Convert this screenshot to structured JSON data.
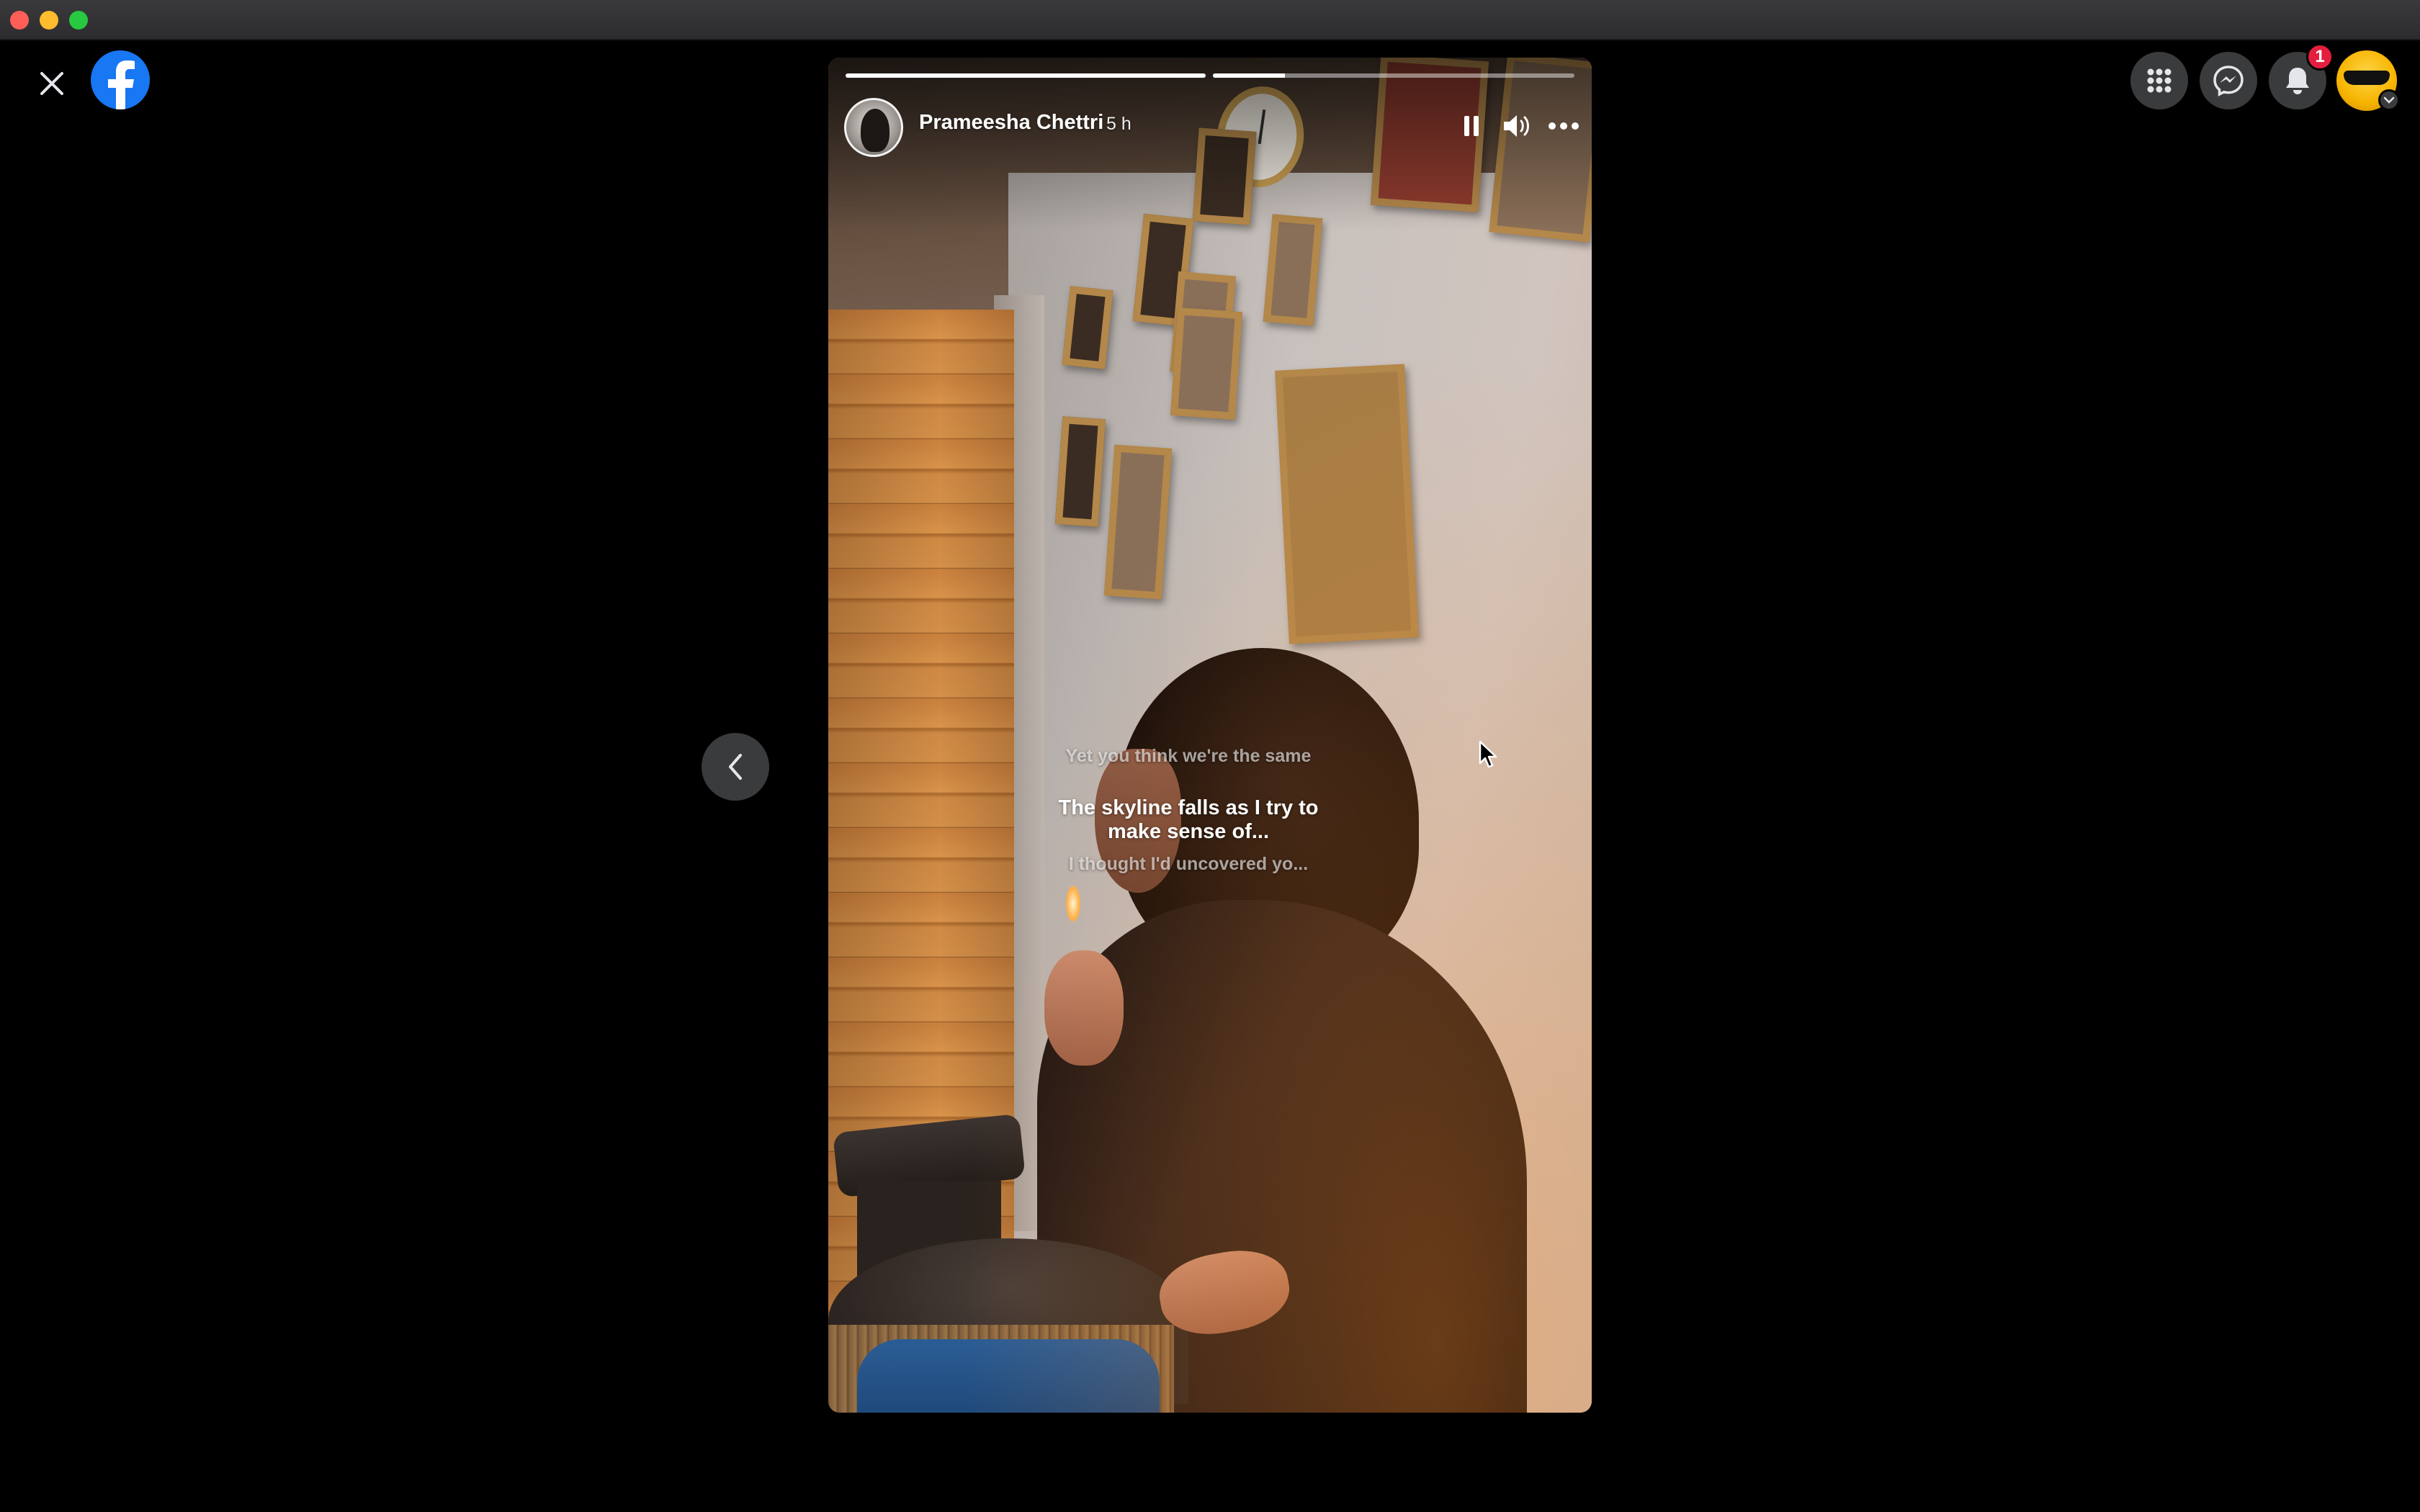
{
  "story": {
    "author_name": "Prameesha Chettri",
    "posted_ago": "5 h",
    "progress": [
      1.0,
      0.2
    ],
    "lyrics": {
      "previous": "Yet you think we're the same",
      "current": "The skyline falls as I try to make sense of...",
      "next": "I thought I'd uncovered yo..."
    }
  },
  "header": {
    "notification_count": "1"
  },
  "icons": {
    "close": "close-icon",
    "logo": "facebook-logo",
    "menu": "grid-menu-icon",
    "messenger": "messenger-icon",
    "notifications": "bell-icon",
    "pause": "pause-icon",
    "sound": "volume-icon",
    "more": "more-icon",
    "previous": "chevron-left-icon"
  },
  "colors": {
    "brand": "#1877f2",
    "badge": "#e41e3f",
    "control_bg": "#3a3b3c"
  }
}
